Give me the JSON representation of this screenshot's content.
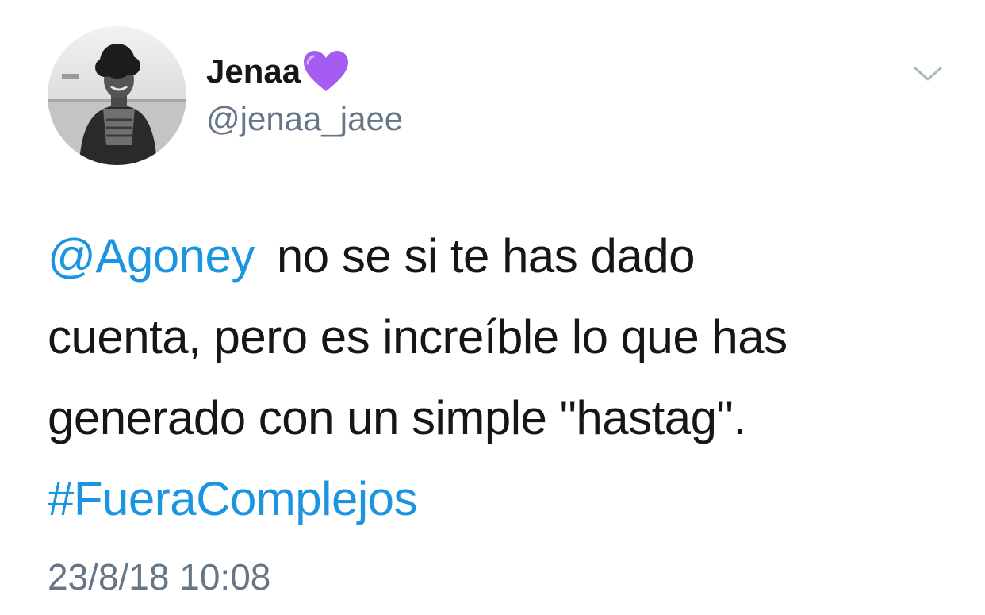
{
  "tweet": {
    "author": {
      "display_name": "Jenaa",
      "name_emoji": "purple-heart-icon",
      "handle": "@jenaa_jaee",
      "avatar": "profile-photo-grayscale"
    },
    "menu_icon": "chevron-down-icon",
    "text": {
      "mention": "@Agoney",
      "line1_rest": "no se si te has dado",
      "line2": "cuenta, pero es increíble lo que has",
      "line3": "generado con un simple \"hastag\".",
      "hashtag": "#FueraComplejos"
    },
    "timestamp": "23/8/18 10:08"
  },
  "colors": {
    "link": "#1b95e0",
    "text": "#14171a",
    "secondary": "#657786",
    "heart": "#a55cf0"
  }
}
